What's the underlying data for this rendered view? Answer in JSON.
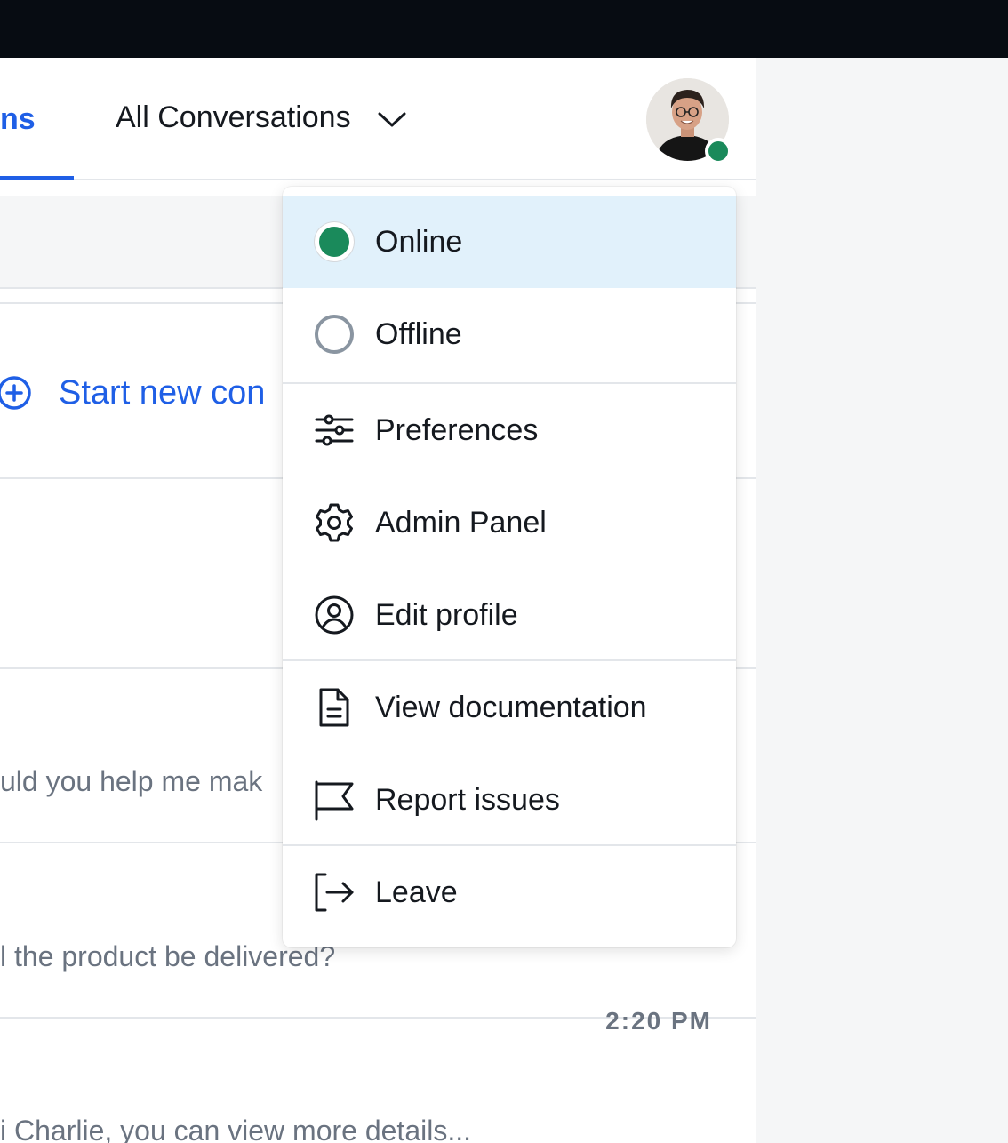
{
  "header": {
    "active_tab_label": "ns",
    "filter_label": "All Conversations",
    "user_status": "online"
  },
  "actions": {
    "start_new_label": "Start new con"
  },
  "conversations": [
    {
      "preview": "uld you help me mak"
    },
    {
      "preview": "l the product be delivered?"
    },
    {
      "time": "2:20 PM",
      "preview": "i Charlie, you can view more details..."
    }
  ],
  "status_menu": {
    "items": [
      {
        "label": "Online",
        "icon": "status-online-dot",
        "selected": true
      },
      {
        "label": "Offline",
        "icon": "status-offline-circle",
        "selected": false
      },
      {
        "label": "Preferences",
        "icon": "sliders-icon"
      },
      {
        "label": "Admin Panel",
        "icon": "gear-icon"
      },
      {
        "label": "Edit profile",
        "icon": "user-circle-icon"
      },
      {
        "label": "View documentation",
        "icon": "document-icon"
      },
      {
        "label": "Report issues",
        "icon": "flag-icon"
      },
      {
        "label": "Leave",
        "icon": "logout-icon"
      }
    ]
  },
  "colors": {
    "accent": "#1f5fe6",
    "online": "#1a8a5b",
    "selected_bg": "#e1f1fb",
    "topbar": "#070c12"
  }
}
